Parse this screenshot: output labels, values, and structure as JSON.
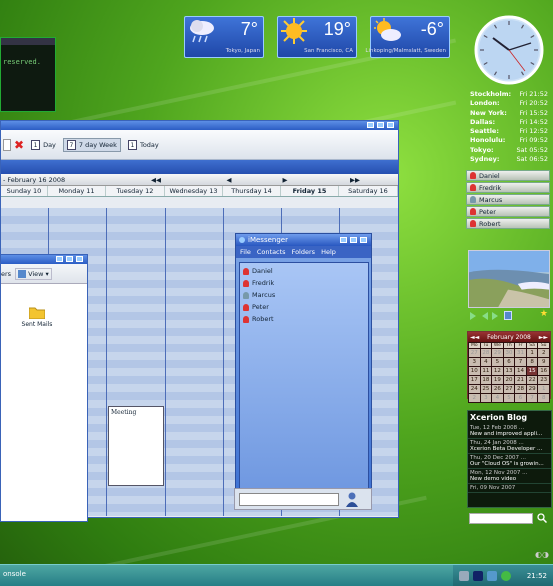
{
  "console": {
    "text": "reserved."
  },
  "weather": [
    {
      "temp": "7°",
      "location": "Tokyo, Japan",
      "icon": "rain-cloud-icon"
    },
    {
      "temp": "19°",
      "location": "San Francisco, CA",
      "icon": "sun-icon"
    },
    {
      "temp": "-6°",
      "location": "Linkoping/Malmslatt, Sweden",
      "icon": "partly-cloudy-icon"
    }
  ],
  "world_times": [
    {
      "city": "Stockholm:",
      "time": "Fri 21:52"
    },
    {
      "city": "London:",
      "time": "Fri 20:52"
    },
    {
      "city": "New York:",
      "time": "Fri 15:52"
    },
    {
      "city": "Dallas:",
      "time": "Fri 14:52"
    },
    {
      "city": "Seattle:",
      "time": "Fri 12:52"
    },
    {
      "city": "Honolulu:",
      "time": "Fri 09:52"
    },
    {
      "city": "Tokyo:",
      "time": "Sat 05:52"
    },
    {
      "city": "Sydney:",
      "time": "Sat 06:52"
    }
  ],
  "right_contacts": [
    {
      "name": "Daniel",
      "status": "#d33"
    },
    {
      "name": "Fredrik",
      "status": "#d33"
    },
    {
      "name": "Marcus",
      "status": "#79a"
    },
    {
      "name": "Peter",
      "status": "#d33"
    },
    {
      "name": "Robert",
      "status": "#d33"
    }
  ],
  "mini_calendar": {
    "title": "February 2008",
    "weekdays": [
      "Mo",
      "Tu",
      "We",
      "Th",
      "Fr",
      "Sa",
      "Su"
    ],
    "weeks": [
      [
        "27",
        "28",
        "29",
        "30",
        "31",
        "1",
        "2"
      ],
      [
        "3",
        "4",
        "5",
        "6",
        "7",
        "8",
        "9"
      ],
      [
        "10",
        "11",
        "12",
        "13",
        "14",
        "15",
        "16"
      ],
      [
        "17",
        "18",
        "19",
        "20",
        "21",
        "22",
        "23"
      ],
      [
        "24",
        "25",
        "26",
        "27",
        "28",
        "29",
        "1"
      ],
      [
        "2",
        "3",
        "4",
        "5",
        "6",
        "7",
        "8"
      ]
    ],
    "today": "15"
  },
  "blog": {
    "title": "Xcerion Blog",
    "items": [
      {
        "date": "Tue, 12 Feb 2008 ...",
        "summary": "New and improved appli..."
      },
      {
        "date": "Thu, 24 Jan 2008 ...",
        "summary": "Xcerion Beta Developer ..."
      },
      {
        "date": "Thu, 20 Dec 2007 ...",
        "summary": "Our \"Cloud OS\" is growin..."
      },
      {
        "date": "Mon, 12 Nov 2007 ...",
        "summary": "New demo video"
      },
      {
        "date": "Fri, 09 Nov 2007",
        "summary": ""
      }
    ]
  },
  "calendar": {
    "toolbar": {
      "day": "Day",
      "day_num": "1",
      "week": "7 day Week",
      "week_num": "7",
      "today": "Today",
      "today_num": "1"
    },
    "range": "- February 16 2008",
    "days": [
      "Sunday 10",
      "Monday 11",
      "Tuesday 12",
      "Wednesday 13",
      "Thursday 14",
      "Friday 15",
      "Saturday 16"
    ],
    "event": "Meeting"
  },
  "explorer": {
    "toolbar_left": "ers",
    "view": "View",
    "folder": "Sent Mails"
  },
  "imessenger": {
    "title": "iMessenger",
    "menu": [
      "File",
      "Contacts",
      "Folders",
      "Help"
    ],
    "contacts": [
      {
        "name": "Daniel",
        "status": "#d33"
      },
      {
        "name": "Fredrik",
        "status": "#d33"
      },
      {
        "name": "Marcus",
        "status": "#79a"
      },
      {
        "name": "Peter",
        "status": "#d33"
      },
      {
        "name": "Robert",
        "status": "#d33"
      }
    ]
  },
  "taskbar": {
    "item": "onsole",
    "clock": "21:52"
  }
}
